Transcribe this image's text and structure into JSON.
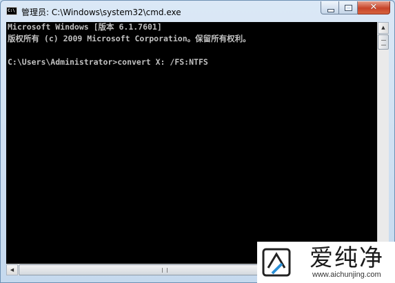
{
  "window": {
    "title": "管理员: C:\\Windows\\system32\\cmd.exe",
    "app_icon_text": "C:\\",
    "close_glyph": "✕"
  },
  "console": {
    "lines": [
      "Microsoft Windows [版本 6.1.7601]",
      "版权所有 (c) 2009 Microsoft Corporation。保留所有权利。",
      "",
      "C:\\Users\\Administrator>convert X: /FS:NTFS"
    ]
  },
  "scrollbar": {
    "up_arrow": "▲",
    "down_arrow": "▼",
    "left_arrow": "◀"
  },
  "watermark": {
    "name": "爱纯净",
    "url": "www.aichunjing.com"
  },
  "icons": [
    "cmd-icon",
    "minimize-icon",
    "maximize-icon",
    "close-icon",
    "watermark-logo-icon"
  ],
  "colors": {
    "console_bg": "#000000",
    "console_text": "#c0c0c0",
    "close_button": "#c7442a",
    "frame": "#c5d9ee"
  }
}
